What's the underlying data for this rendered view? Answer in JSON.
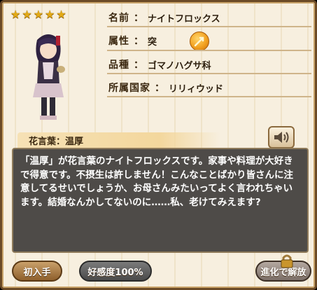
{
  "card": {
    "stars": [
      "★",
      "★",
      "★",
      "★",
      "★"
    ],
    "info": {
      "name_label": "名前",
      "name_value": "ナイトフロックス",
      "attr_label": "属性",
      "attr_value": "突",
      "attr_icon": "thrust-attribute-icon",
      "family_label": "品種",
      "family_value": "ゴマノハグサ科",
      "nation_label": "所属国家",
      "nation_value": "リリィウッド"
    },
    "colon": "：",
    "hanakotoba": {
      "label": "花言葉：温厚",
      "text": "「温厚」が花言葉のナイトフロックスです。家事や料理が大好きで得意です。不摂生は許しません！こんなことばかり皆さんに注意してるせいでしょうか、お母さんみたいってよく言われちゃいます。結婚なんかしてないのに……私、老けてみえます?"
    },
    "buttons": {
      "first_label": "初入手",
      "affection_label": "好感度100%",
      "evolve_label": "進化で解放"
    },
    "colors": {
      "frame": "#6b4a26",
      "text_box_bg": "#4e4b48",
      "star": "#e2a915"
    }
  }
}
